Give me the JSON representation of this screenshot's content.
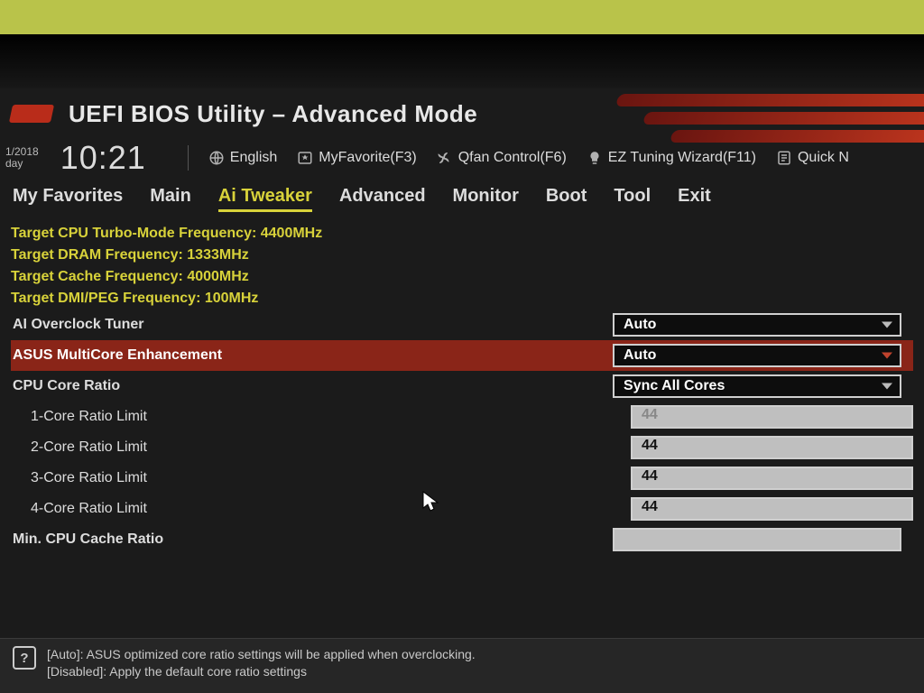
{
  "header": {
    "title": "UEFI BIOS Utility – Advanced Mode",
    "date_top": "1/2018",
    "date_bottom": "day",
    "time": "10:21",
    "toolbar": {
      "language": "English",
      "favorite": "MyFavorite(F3)",
      "qfan": "Qfan Control(F6)",
      "ez": "EZ Tuning Wizard(F11)",
      "quick": "Quick N"
    }
  },
  "tabs": {
    "favorites": "My Favorites",
    "main": "Main",
    "aitweaker": "Ai Tweaker",
    "advanced": "Advanced",
    "monitor": "Monitor",
    "boot": "Boot",
    "tool": "Tool",
    "exit": "Exit",
    "active": "aitweaker"
  },
  "targets": [
    "Target CPU Turbo-Mode Frequency: 4400MHz",
    "Target DRAM Frequency: 1333MHz",
    "Target Cache Frequency: 4000MHz",
    "Target DMI/PEG Frequency: 100MHz"
  ],
  "settings": {
    "ai_overclock": {
      "label": "AI Overclock Tuner",
      "value": "Auto"
    },
    "multicore": {
      "label": "ASUS MultiCore Enhancement",
      "value": "Auto"
    },
    "core_ratio": {
      "label": "CPU Core Ratio",
      "value": "Sync All Cores"
    },
    "core1": {
      "label": "1-Core Ratio Limit",
      "value": "44"
    },
    "core2": {
      "label": "2-Core Ratio Limit",
      "value": "44"
    },
    "core3": {
      "label": "3-Core Ratio Limit",
      "value": "44"
    },
    "core4": {
      "label": "4-Core Ratio Limit",
      "value": "44"
    },
    "min_cache": {
      "label": "Min. CPU Cache Ratio",
      "value": ""
    }
  },
  "help": {
    "line1": "[Auto]: ASUS optimized core ratio settings will be applied when overclocking.",
    "line2": "[Disabled]: Apply the default core ratio settings"
  }
}
